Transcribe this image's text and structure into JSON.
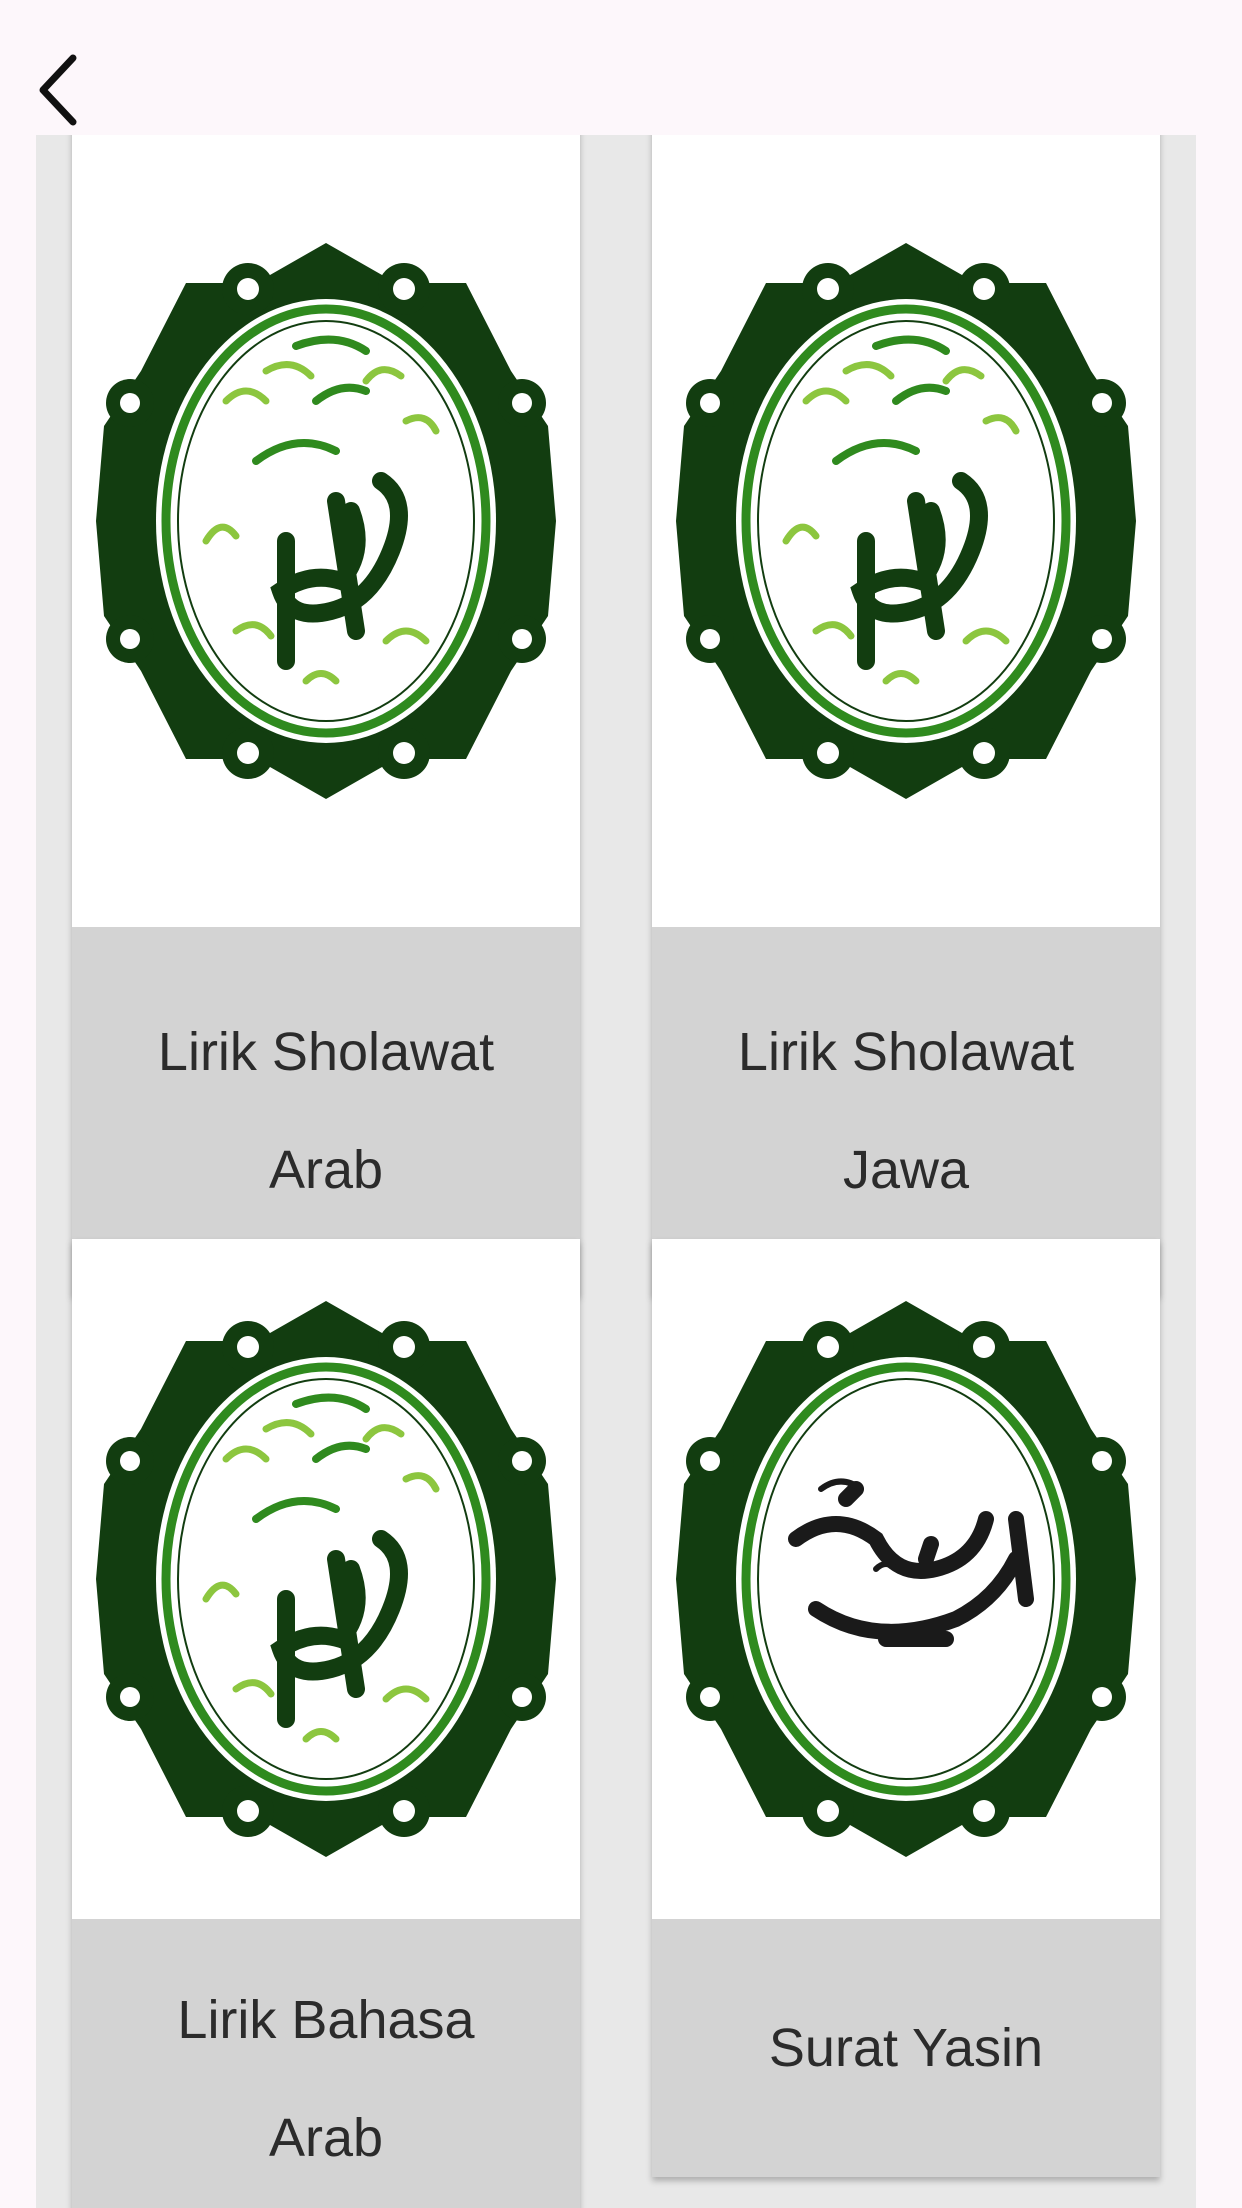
{
  "appbar": {
    "back_icon": "chevron-left-icon"
  },
  "cards": [
    {
      "label": "Lirik Sholawat Arab",
      "emblem": "muhammad-calligraphy-emblem"
    },
    {
      "label": "Lirik Sholawat Jawa",
      "emblem": "muhammad-calligraphy-emblem"
    },
    {
      "label": "Lirik Bahasa Arab",
      "emblem": "muhammad-calligraphy-emblem"
    },
    {
      "label": "Surat Yasin",
      "emblem": "yasin-calligraphy-emblem"
    }
  ],
  "colors": {
    "emblem_dark_green": "#123d10",
    "emblem_ring_green": "#2f8a1e",
    "calligraphy_light_green": "#8cc63f",
    "label_background": "#d3d3d3",
    "grid_background": "#e8e8e8"
  }
}
